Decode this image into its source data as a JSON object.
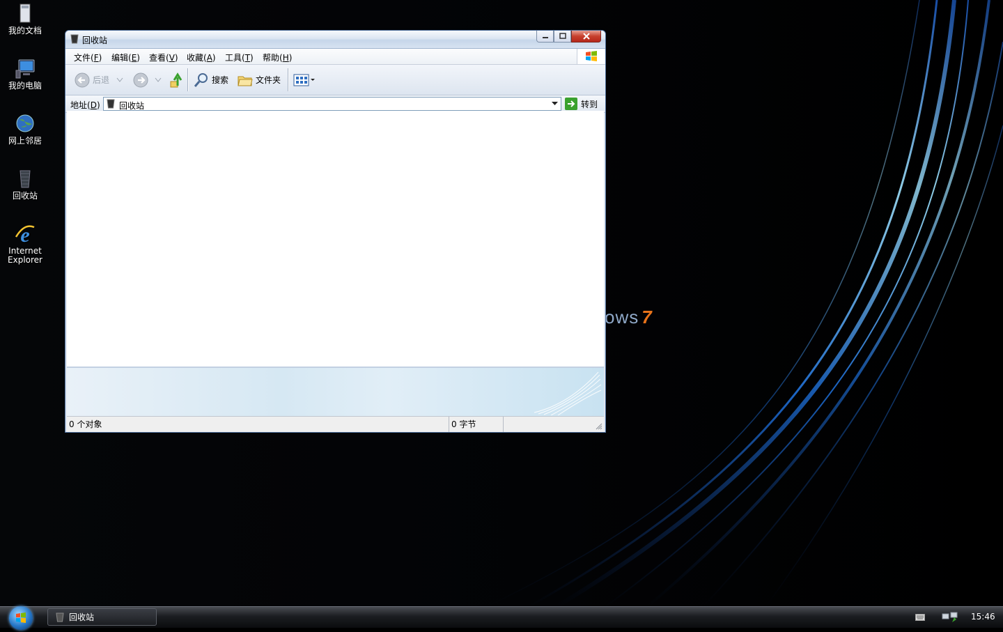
{
  "desktop": {
    "brand_text": "ows",
    "brand_seven": "7",
    "icons": [
      {
        "label": "我的文档",
        "icon": "documents-icon"
      },
      {
        "label": "我的电脑",
        "icon": "computer-icon"
      },
      {
        "label": "网上邻居",
        "icon": "network-icon"
      },
      {
        "label": "回收站",
        "icon": "recycle-bin-icon"
      },
      {
        "label": "Internet Explorer",
        "icon": "internet-explorer-icon"
      }
    ]
  },
  "window": {
    "title": "回收站",
    "menu": [
      {
        "label": "文件",
        "accel": "F"
      },
      {
        "label": "编辑",
        "accel": "E"
      },
      {
        "label": "查看",
        "accel": "V"
      },
      {
        "label": "收藏",
        "accel": "A"
      },
      {
        "label": "工具",
        "accel": "T"
      },
      {
        "label": "帮助",
        "accel": "H"
      }
    ],
    "toolbar": {
      "back": "后退",
      "search": "搜索",
      "folders": "文件夹"
    },
    "address": {
      "label": "地址",
      "accel": "D",
      "value": "回收站",
      "go": "转到"
    },
    "status": {
      "objects": "0 个对象",
      "size": "0 字节"
    }
  },
  "taskbar": {
    "task_label": "回收站",
    "clock": "15:46"
  },
  "colors": {
    "accent": "#2f6fc1",
    "title_text": "#000000",
    "taskbar": "#1b1d21",
    "close_button": "#c7402d"
  }
}
